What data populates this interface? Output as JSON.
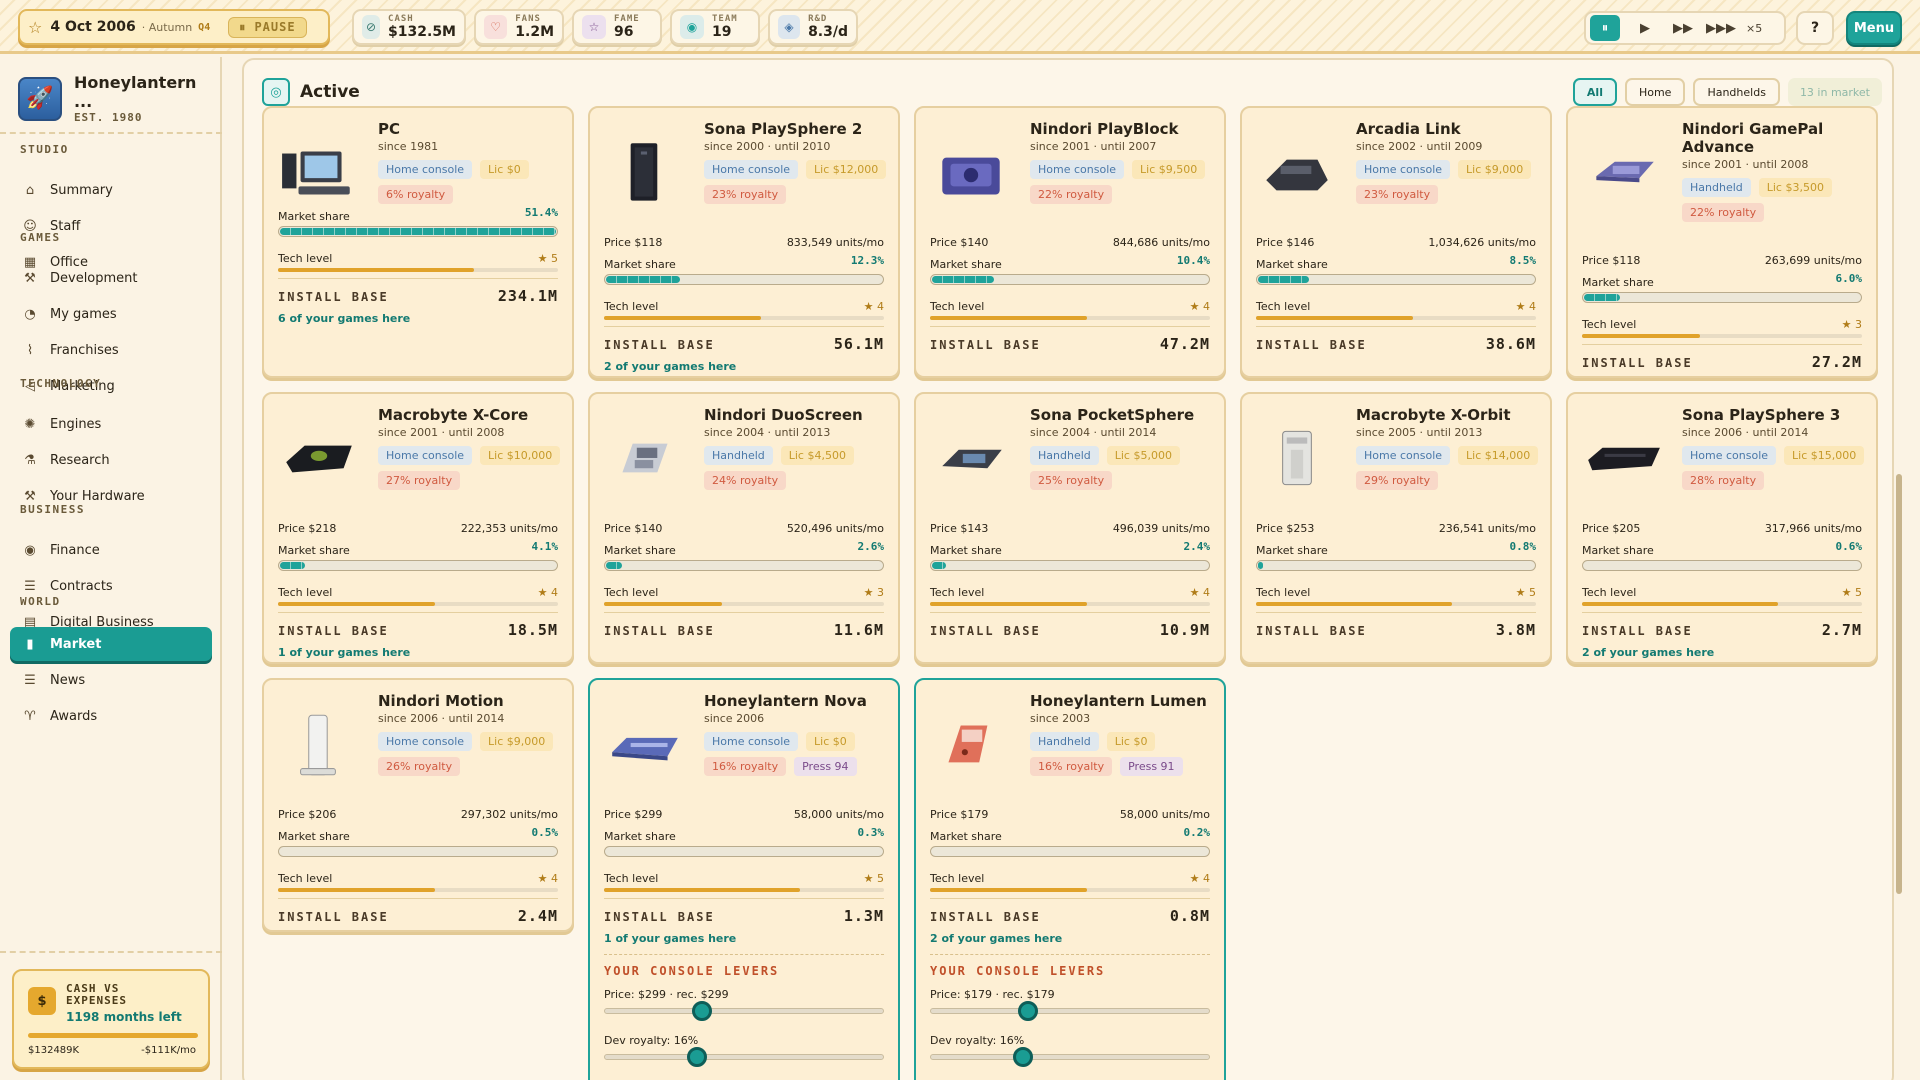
{
  "topbar": {
    "date": "4 Oct 2006",
    "season": "· Autumn",
    "quarter": "Q4",
    "pause_label": "PAUSE",
    "stats": [
      {
        "label": "CASH",
        "value": "$132.5M",
        "icon": "coin-icon"
      },
      {
        "label": "FANS",
        "value": "1.2M",
        "icon": "heart-icon"
      },
      {
        "label": "FAME",
        "value": "96",
        "icon": "star-icon"
      },
      {
        "label": "TEAM",
        "value": "19",
        "icon": "team-icon"
      },
      {
        "label": "R&D",
        "value": "8.3/d",
        "icon": "flask-icon"
      }
    ],
    "speed_multiplier": "×5",
    "help_label": "?",
    "menu_label": "Menu"
  },
  "sidebar": {
    "studio_name": "Honeylantern ...",
    "established": "EST. 1980",
    "sections": [
      {
        "title": "STUDIO",
        "items": [
          "Summary",
          "Staff",
          "Office"
        ]
      },
      {
        "title": "GAMES",
        "items": [
          "Development",
          "My games",
          "Franchises",
          "Marketing"
        ]
      },
      {
        "title": "TECHNOLOGY",
        "items": [
          "Engines",
          "Research",
          "Your Hardware"
        ]
      },
      {
        "title": "BUSINESS",
        "items": [
          "Finance",
          "Contracts",
          "Digital Business"
        ]
      },
      {
        "title": "WORLD",
        "items": [
          "Market",
          "News",
          "Awards"
        ]
      }
    ],
    "active_item": "Market",
    "cash_card": {
      "title": "CASH VS EXPENSES",
      "months_left": "1198 months left",
      "cash": "$132489K",
      "expenses": "-$111K/mo"
    }
  },
  "main": {
    "title": "Active",
    "filters": [
      "All",
      "Home",
      "Handhelds"
    ],
    "active_filter": "All",
    "market_count": "13 in market",
    "labels": {
      "market_share": "Market share",
      "tech_level": "Tech level",
      "install_base": "INSTALL BASE",
      "levers": "YOUR CONSOLE LEVERS"
    },
    "consoles": [
      {
        "name": "PC",
        "since": "since 1981",
        "type": "Home console",
        "license": "Lic $0",
        "royalty": "6% royalty",
        "price": "",
        "units": "",
        "share": "51.4%",
        "share_value": 51.4,
        "tech": 5,
        "install_base": "234.1M",
        "games": "6 of your games here",
        "own": false,
        "press": ""
      },
      {
        "name": "Sona PlaySphere 2",
        "since": "since 2000 · until 2010",
        "type": "Home console",
        "license": "Lic $12,000",
        "royalty": "23% royalty",
        "price": "Price $118",
        "units": "833,549 units/mo",
        "share": "12.3%",
        "share_value": 12.3,
        "tech": 4,
        "install_base": "56.1M",
        "games": "2 of your games here",
        "own": false,
        "press": ""
      },
      {
        "name": "Nindori PlayBlock",
        "since": "since 2001 · until 2007",
        "type": "Home console",
        "license": "Lic $9,500",
        "royalty": "22% royalty",
        "price": "Price $140",
        "units": "844,686 units/mo",
        "share": "10.4%",
        "share_value": 10.4,
        "tech": 4,
        "install_base": "47.2M",
        "games": "",
        "own": false,
        "press": ""
      },
      {
        "name": "Arcadia Link",
        "since": "since 2002 · until 2009",
        "type": "Home console",
        "license": "Lic $9,000",
        "royalty": "23% royalty",
        "price": "Price $146",
        "units": "1,034,626 units/mo",
        "share": "8.5%",
        "share_value": 8.5,
        "tech": 4,
        "install_base": "38.6M",
        "games": "",
        "own": false,
        "press": ""
      },
      {
        "name": "Nindori GamePal Advance",
        "since": "since 2001 · until 2008",
        "type": "Handheld",
        "license": "Lic $3,500",
        "royalty": "22% royalty",
        "price": "Price $118",
        "units": "263,699 units/mo",
        "share": "6.0%",
        "share_value": 6.0,
        "tech": 3,
        "install_base": "27.2M",
        "games": "",
        "own": false,
        "press": ""
      },
      {
        "name": "Macrobyte X-Core",
        "since": "since 2001 · until 2008",
        "type": "Home console",
        "license": "Lic $10,000",
        "royalty": "27% royalty",
        "price": "Price $218",
        "units": "222,353 units/mo",
        "share": "4.1%",
        "share_value": 4.1,
        "tech": 4,
        "install_base": "18.5M",
        "games": "1 of your games here",
        "own": false,
        "press": ""
      },
      {
        "name": "Nindori DuoScreen",
        "since": "since 2004 · until 2013",
        "type": "Handheld",
        "license": "Lic $4,500",
        "royalty": "24% royalty",
        "price": "Price $140",
        "units": "520,496 units/mo",
        "share": "2.6%",
        "share_value": 2.6,
        "tech": 3,
        "install_base": "11.6M",
        "games": "",
        "own": false,
        "press": ""
      },
      {
        "name": "Sona PocketSphere",
        "since": "since 2004 · until 2014",
        "type": "Handheld",
        "license": "Lic $5,000",
        "royalty": "25% royalty",
        "price": "Price $143",
        "units": "496,039 units/mo",
        "share": "2.4%",
        "share_value": 2.4,
        "tech": 4,
        "install_base": "10.9M",
        "games": "",
        "own": false,
        "press": ""
      },
      {
        "name": "Macrobyte X-Orbit",
        "since": "since 2005 · until 2013",
        "type": "Home console",
        "license": "Lic $14,000",
        "royalty": "29% royalty",
        "price": "Price $253",
        "units": "236,541 units/mo",
        "share": "0.8%",
        "share_value": 0.8,
        "tech": 5,
        "install_base": "3.8M",
        "games": "",
        "own": false,
        "press": ""
      },
      {
        "name": "Sona PlaySphere 3",
        "since": "since 2006 · until 2014",
        "type": "Home console",
        "license": "Lic $15,000",
        "royalty": "28% royalty",
        "price": "Price $205",
        "units": "317,966 units/mo",
        "share": "0.6%",
        "share_value": 0.6,
        "tech": 5,
        "install_base": "2.7M",
        "games": "2 of your games here",
        "own": false,
        "press": ""
      },
      {
        "name": "Nindori Motion",
        "since": "since 2006 · until 2014",
        "type": "Home console",
        "license": "Lic $9,000",
        "royalty": "26% royalty",
        "price": "Price $206",
        "units": "297,302 units/mo",
        "share": "0.5%",
        "share_value": 0.5,
        "tech": 4,
        "install_base": "2.4M",
        "games": "",
        "own": false,
        "press": ""
      },
      {
        "name": "Honeylantern Nova",
        "since": "since 2006",
        "type": "Home console",
        "license": "Lic $0",
        "royalty": "16% royalty",
        "price": "Price $299",
        "units": "58,000 units/mo",
        "share": "0.3%",
        "share_value": 0.3,
        "tech": 5,
        "install_base": "1.3M",
        "games": "1 of your games here",
        "own": true,
        "press": "Press 94",
        "lever_price": "Price: $299 · rec. $299",
        "lever_royalty": "Dev royalty: 16%",
        "price_pos": 0.35,
        "royalty_pos": 0.33
      },
      {
        "name": "Honeylantern Lumen",
        "since": "since 2003",
        "type": "Handheld",
        "license": "Lic $0",
        "royalty": "16% royalty",
        "price": "Price $179",
        "units": "58,000 units/mo",
        "share": "0.2%",
        "share_value": 0.2,
        "tech": 4,
        "install_base": "0.8M",
        "games": "2 of your games here",
        "own": true,
        "press": "Press 91",
        "lever_price": "Price: $179 · rec. $179",
        "lever_royalty": "Dev royalty: 16%",
        "price_pos": 0.35,
        "royalty_pos": 0.33
      }
    ]
  }
}
